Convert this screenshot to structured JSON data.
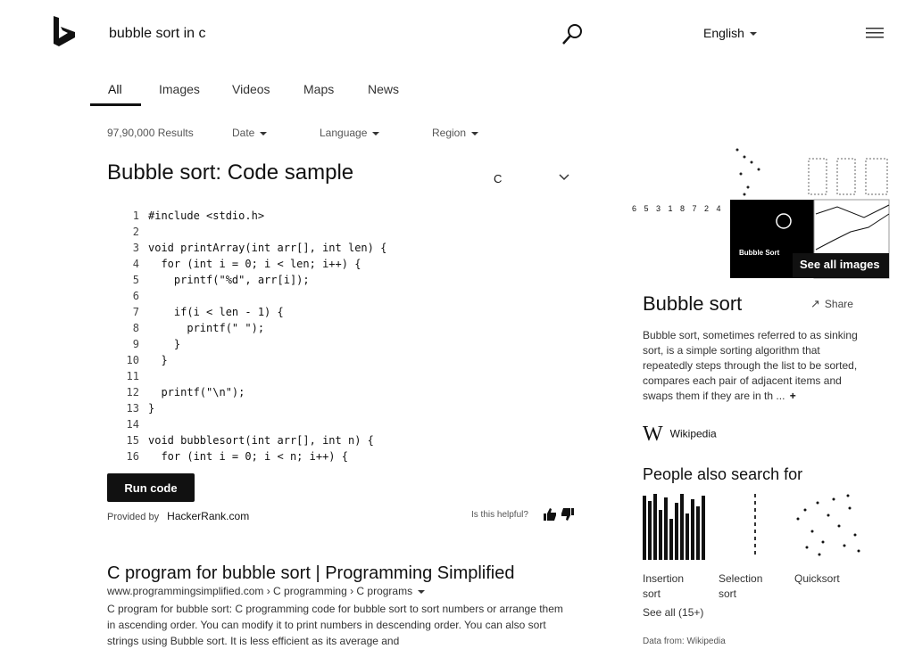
{
  "header": {
    "search_query": "bubble sort in c",
    "language_label": "English",
    "icons": {
      "logo": "bing-logo-icon",
      "search": "search-icon",
      "menu": "hamburger-menu-icon"
    }
  },
  "tabs": [
    {
      "label": "All",
      "active": true
    },
    {
      "label": "Images",
      "active": false
    },
    {
      "label": "Videos",
      "active": false
    },
    {
      "label": "Maps",
      "active": false
    },
    {
      "label": "News",
      "active": false
    }
  ],
  "filters": {
    "result_count": "97,90,000 Results",
    "date": "Date",
    "language": "Language",
    "region": "Region"
  },
  "code_sample": {
    "title": "Bubble sort: Code sample",
    "language": "C",
    "lines": [
      {
        "n": "1",
        "code": "#include <stdio.h>"
      },
      {
        "n": "2",
        "code": ""
      },
      {
        "n": "3",
        "code": "void printArray(int arr[], int len) {"
      },
      {
        "n": "4",
        "code": "  for (int i = 0; i < len; i++) {"
      },
      {
        "n": "5",
        "code": "    printf(\"%d\", arr[i]);"
      },
      {
        "n": "6",
        "code": ""
      },
      {
        "n": "7",
        "code": "    if(i < len - 1) {"
      },
      {
        "n": "8",
        "code": "      printf(\" \");"
      },
      {
        "n": "9",
        "code": "    }"
      },
      {
        "n": "10",
        "code": "  }"
      },
      {
        "n": "11",
        "code": ""
      },
      {
        "n": "12",
        "code": "  printf(\"\\n\");"
      },
      {
        "n": "13",
        "code": "}"
      },
      {
        "n": "14",
        "code": ""
      },
      {
        "n": "15",
        "code": "void bubblesort(int arr[], int n) {"
      },
      {
        "n": "16",
        "code": "  for (int i = 0; i < n; i++) {"
      }
    ],
    "run_button": "Run code",
    "provider_label": "Provided by",
    "provider_name": "HackerRank.com",
    "helpful_label": "Is this helpful?"
  },
  "result": {
    "title": "C program for bubble sort | Programming Simplified",
    "url": "www.programmingsimplified.com › C programming › C programs",
    "snippet_1": "C program for bubble sort: C programming code for bubble sort to sort numbers or arrange them in ascending order. You can modify it to print numbers in descending order. You can also sort strings using Bubble sort. It is less efficient as its average and"
  },
  "knowledge_panel": {
    "images_overlay": "See all images",
    "thumb_caption": "Bubble Sort",
    "number_strip": "6 5 3 1 8 7 2 4",
    "title": "Bubble sort",
    "share_label": "Share",
    "description": "Bubble sort, sometimes referred to as sinking sort, is a simple sorting algorithm that repeatedly steps through the list to be sorted, compares each pair of adjacent items and swaps them if they are in th ...",
    "source": "Wikipedia",
    "people_also_search": "People also search for",
    "pas_items": [
      {
        "label_1": "Insertion",
        "label_2": "sort"
      },
      {
        "label_1": "Selection",
        "label_2": "sort"
      },
      {
        "label_1": "Quicksort",
        "label_2": ""
      }
    ],
    "see_all": "See all (15+)",
    "data_from": "Data from: Wikipedia"
  }
}
